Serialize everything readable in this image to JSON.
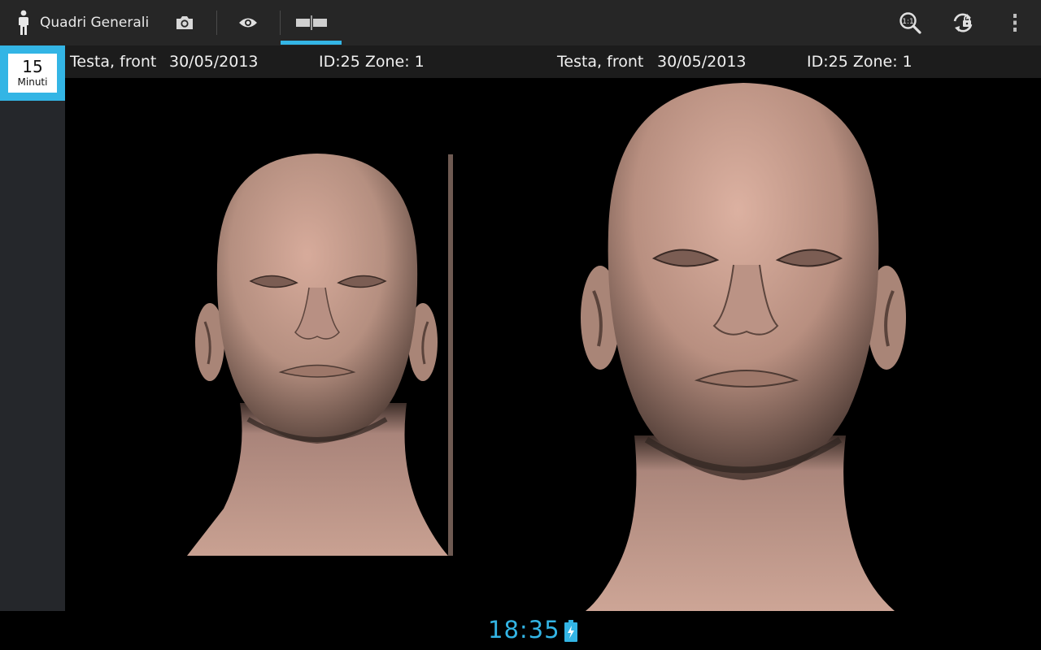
{
  "actionbar": {
    "app_title": "Quadri Generali",
    "icons": [
      "person-icon",
      "camera-icon",
      "eye-icon",
      "compare-icon",
      "zoom-1to1-icon",
      "sync-lock-icon",
      "overflow-menu-icon"
    ],
    "accent_color": "#33b5e5"
  },
  "timer": {
    "value": "15",
    "unit": "Minuti"
  },
  "left_view": {
    "title": "Testa, front",
    "date": "30/05/2013",
    "meta": "ID:25 Zone: 1"
  },
  "right_view": {
    "title": "Testa, front",
    "date": "30/05/2013",
    "meta": "ID:25 Zone: 1"
  },
  "status": {
    "time": "18:35",
    "battery_icon": "battery-charging-icon"
  }
}
